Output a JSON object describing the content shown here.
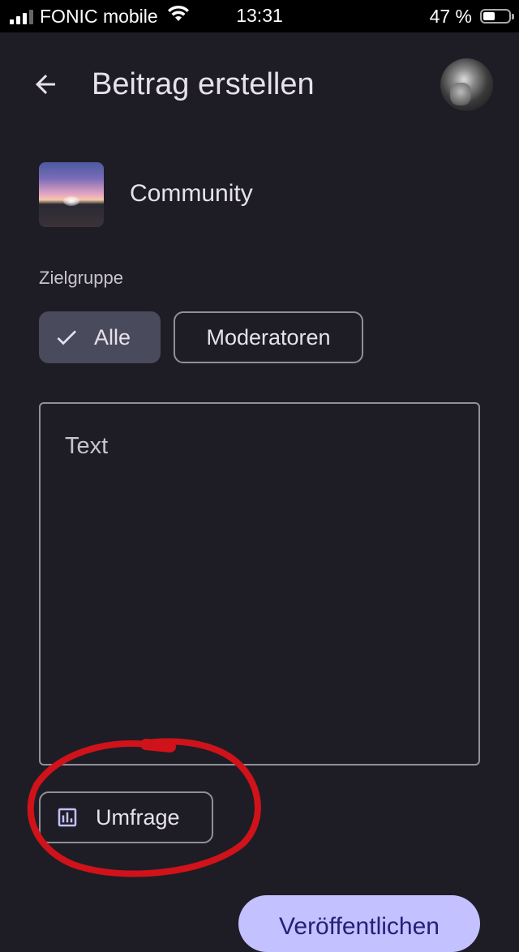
{
  "status_bar": {
    "carrier": "FONIC mobile",
    "time": "13:31",
    "battery_text": "47 %",
    "battery_level": 0.47
  },
  "header": {
    "back_icon": "arrow-left-icon",
    "title": "Beitrag erstellen",
    "avatar_icon": "user-avatar"
  },
  "community": {
    "name": "Community"
  },
  "audience": {
    "label": "Zielgruppe",
    "options": [
      {
        "label": "Alle",
        "selected": true
      },
      {
        "label": "Moderatoren",
        "selected": false
      }
    ]
  },
  "post": {
    "placeholder": "Text",
    "value": ""
  },
  "poll": {
    "label": "Umfrage",
    "icon": "bar-chart-icon"
  },
  "publish": {
    "label": "Veröffentlichen"
  },
  "colors": {
    "background": "#1e1d25",
    "chip_selected": "#4a4a5d",
    "outline": "#928f99",
    "accent": "#c3c1ff",
    "annotation": "#d0121a"
  }
}
